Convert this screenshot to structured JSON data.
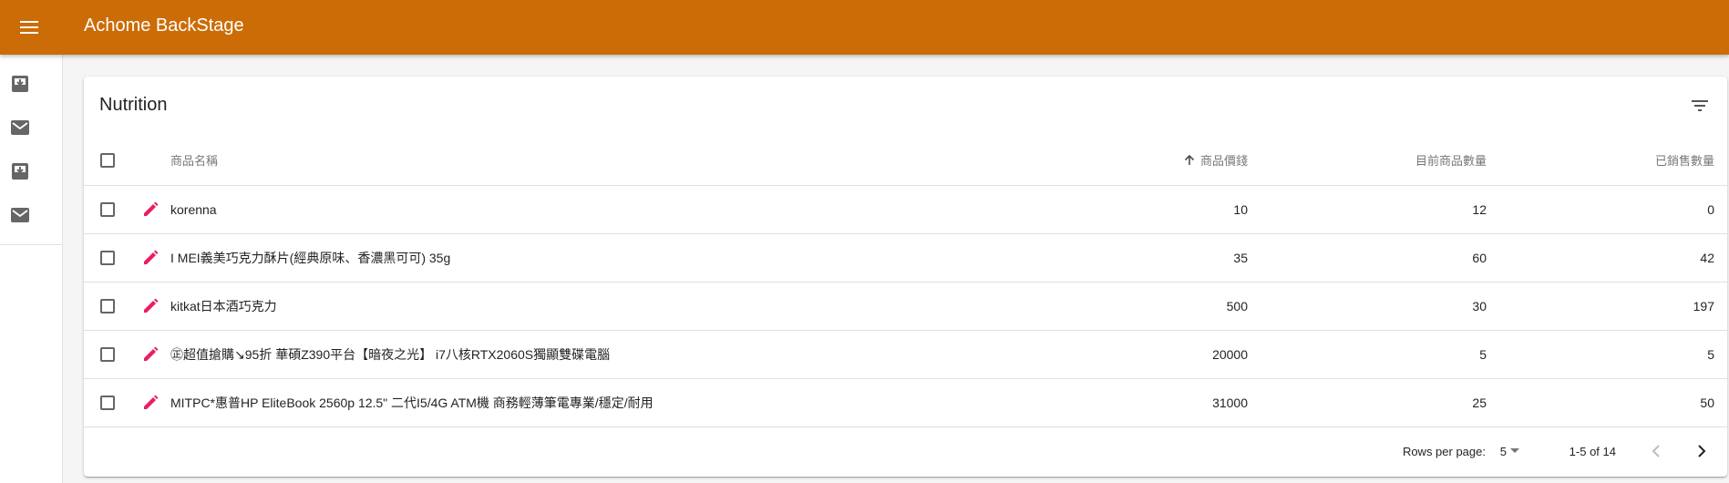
{
  "app": {
    "title": "Achome BackStage",
    "bar_color": "#cc6c06"
  },
  "drawer": {
    "items": [
      {
        "icon": "move-to-inbox-icon"
      },
      {
        "icon": "mail-icon"
      },
      {
        "icon": "move-to-inbox-icon"
      },
      {
        "icon": "mail-icon"
      }
    ]
  },
  "table": {
    "title": "Nutrition",
    "headers": {
      "name": "商品名稱",
      "price": "商品價錢",
      "stock": "目前商品數量",
      "sold": "已銷售數量"
    },
    "sort_column": "price",
    "edit_icon_color": "#e91e63",
    "rows": [
      {
        "name": "korenna",
        "price": "10",
        "stock": "12",
        "sold": "0"
      },
      {
        "name": "I MEI義美巧克力酥片(經典原味、香濃黑可可) 35g",
        "price": "35",
        "stock": "60",
        "sold": "42"
      },
      {
        "name": "kitkat日本酒巧克力",
        "price": "500",
        "stock": "30",
        "sold": "197"
      },
      {
        "name": "㊣超值搶購↘95折 華碩Z390平台【暗夜之光】 i7八核RTX2060S獨顯雙碟電腦",
        "price": "20000",
        "stock": "5",
        "sold": "5"
      },
      {
        "name": "MITPC*惠普HP EliteBook 2560p 12.5\" 二代I5/4G ATM機 商務輕薄筆電專業/穩定/耐用",
        "price": "31000",
        "stock": "25",
        "sold": "50"
      }
    ]
  },
  "pagination": {
    "rows_label": "Rows per page:",
    "rows_value": "5",
    "range": "1-5 of 14"
  }
}
